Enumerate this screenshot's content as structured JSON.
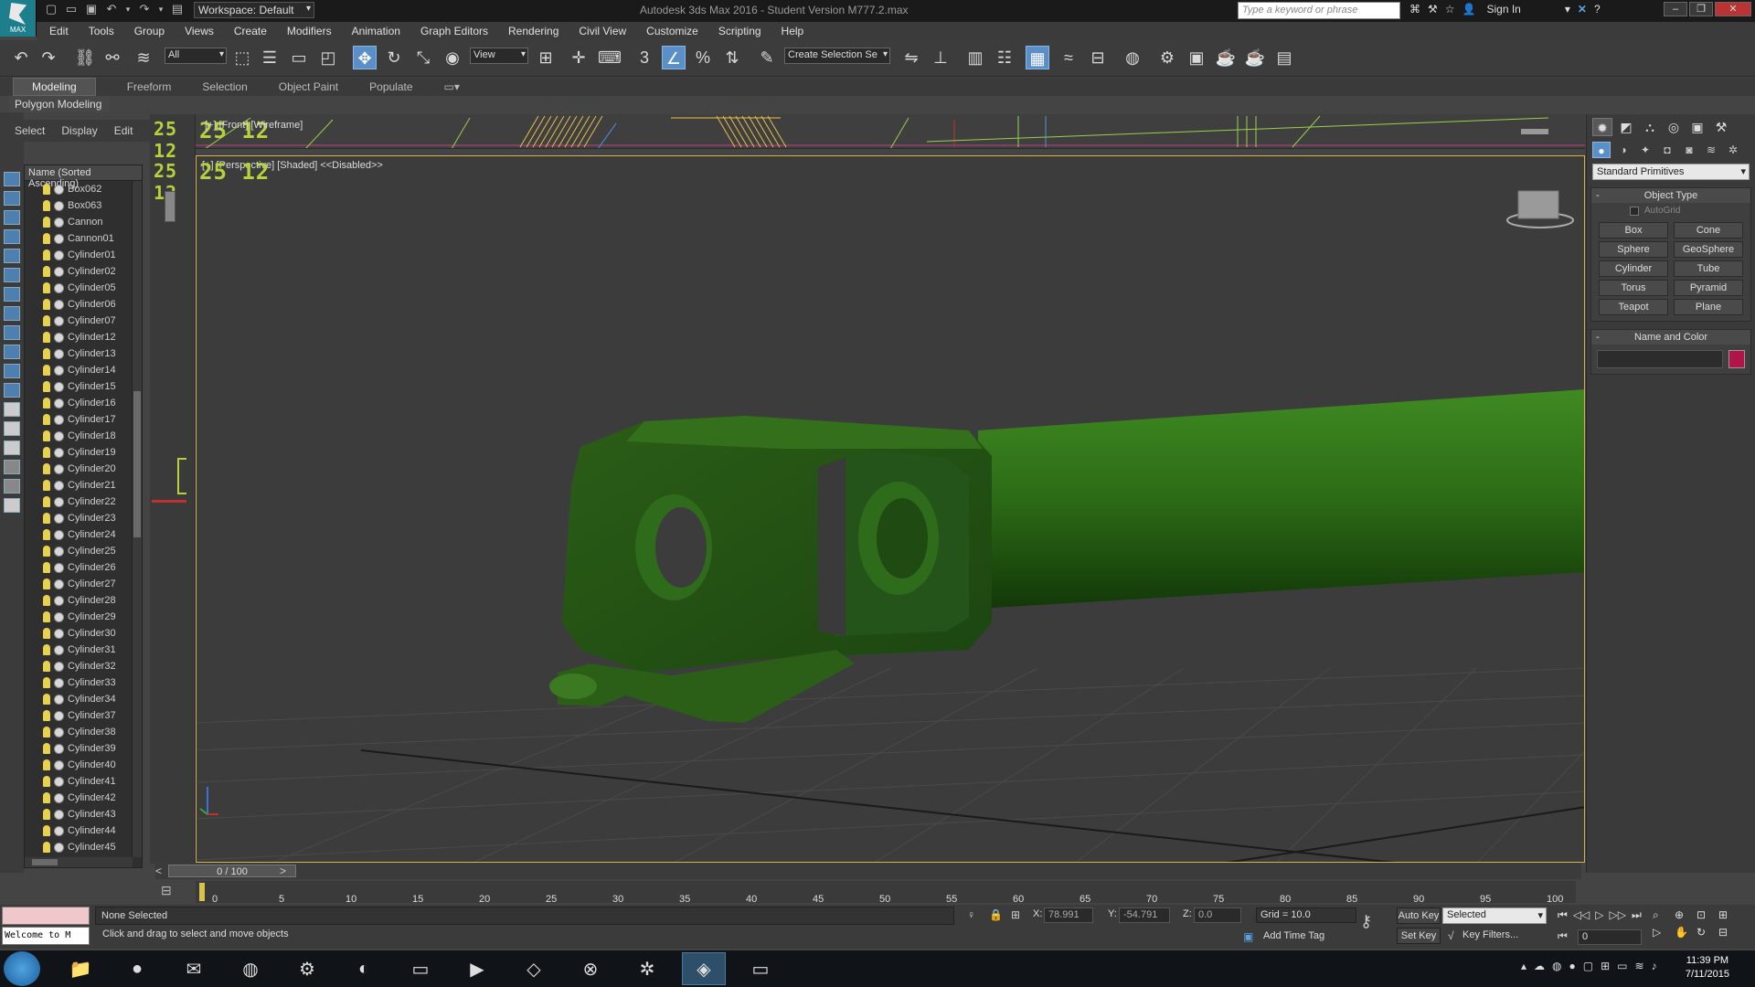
{
  "window": {
    "title": "Autodesk 3ds Max 2016 - Student Version    M777.2.max",
    "workspace": "Workspace: Default",
    "search_placeholder": "Type a keyword or phrase",
    "sign_in": "Sign In",
    "logo_text": "MAX"
  },
  "menu": [
    "Edit",
    "Tools",
    "Group",
    "Views",
    "Create",
    "Modifiers",
    "Animation",
    "Graph Editors",
    "Rendering",
    "Civil View",
    "Customize",
    "Scripting",
    "Help"
  ],
  "toolbar": {
    "selection_filter": "All",
    "ref_coord": "View",
    "named_selection": "Create Selection Se",
    "snap_label": "3"
  },
  "ribbon": {
    "tabs": [
      "Modeling",
      "Freeform",
      "Selection",
      "Object Paint",
      "Populate"
    ],
    "active_tab": "Modeling",
    "subtitle": "Polygon Modeling"
  },
  "scene_explorer": {
    "tabs": [
      "Select",
      "Display",
      "Edit"
    ],
    "header": "Name (Sorted Ascending)",
    "items": [
      "Box062",
      "Box063",
      "Cannon",
      "Cannon01",
      "Cylinder01",
      "Cylinder02",
      "Cylinder05",
      "Cylinder06",
      "Cylinder07",
      "Cylinder12",
      "Cylinder13",
      "Cylinder14",
      "Cylinder15",
      "Cylinder16",
      "Cylinder17",
      "Cylinder18",
      "Cylinder19",
      "Cylinder20",
      "Cylinder21",
      "Cylinder22",
      "Cylinder23",
      "Cylinder24",
      "Cylinder25",
      "Cylinder26",
      "Cylinder27",
      "Cylinder28",
      "Cylinder29",
      "Cylinder30",
      "Cylinder31",
      "Cylinder32",
      "Cylinder33",
      "Cylinder34",
      "Cylinder37",
      "Cylinder38",
      "Cylinder39",
      "Cylinder40",
      "Cylinder41",
      "Cylinder42",
      "Cylinder43",
      "Cylinder44",
      "Cylinder45"
    ]
  },
  "viewports": {
    "front_caption": "[+] [Front] [Wireframe]",
    "persp_caption": "[+] [Perspective] [Shaded] <<Disabled>>",
    "fps_label": "25 12",
    "fps_label_alt": "25 12",
    "object_color": "#2e6b1a"
  },
  "command_panel": {
    "category": "Standard Primitives",
    "object_type_title": "Object Type",
    "autogrid": "AutoGrid",
    "buttons": [
      "Box",
      "Cone",
      "Sphere",
      "GeoSphere",
      "Cylinder",
      "Tube",
      "Torus",
      "Pyramid",
      "Teapot",
      "Plane"
    ],
    "name_color_title": "Name and Color",
    "swatch_color": "#b0154a"
  },
  "timeline": {
    "slider": "0 / 100",
    "ticks": [
      "0",
      "5",
      "10",
      "15",
      "20",
      "25",
      "30",
      "35",
      "40",
      "45",
      "50",
      "55",
      "60",
      "65",
      "70",
      "75",
      "80",
      "85",
      "90",
      "95",
      "100"
    ]
  },
  "status": {
    "maxscript": "Welcome to M",
    "selection": "None Selected",
    "prompt": "Click and drag to select and move objects",
    "x_label": "X:",
    "x": "78.991",
    "y_label": "Y:",
    "y": "-54.791",
    "z_label": "Z:",
    "z": "0.0",
    "grid": "Grid = 10.0",
    "add_time_tag": "Add Time Tag",
    "auto_key": "Auto Key",
    "set_key": "Set Key",
    "selected": "Selected",
    "key_filters": "Key Filters...",
    "frame": "0"
  },
  "clock": {
    "time": "11:39 PM",
    "date": "7/11/2015"
  }
}
